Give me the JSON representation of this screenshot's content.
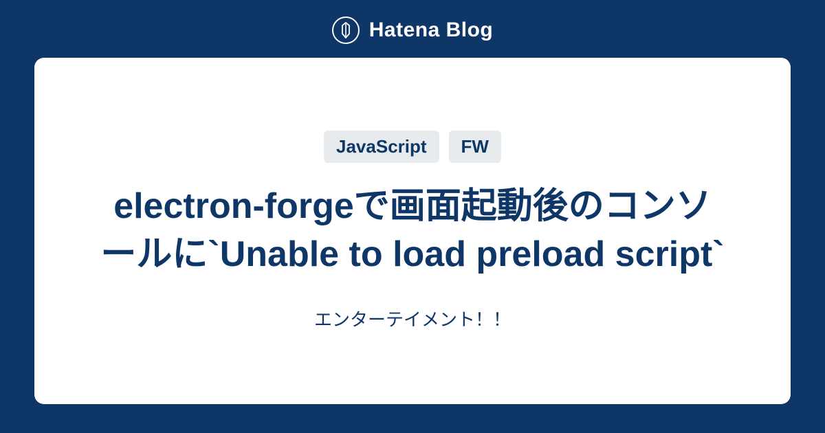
{
  "header": {
    "brand": "Hatena Blog"
  },
  "card": {
    "tags": [
      "JavaScript",
      "FW"
    ],
    "title": "electron-forgeで画面起動後のコンソールに`Unable to load preload script`",
    "subtitle": "エンターテイメント！！"
  }
}
